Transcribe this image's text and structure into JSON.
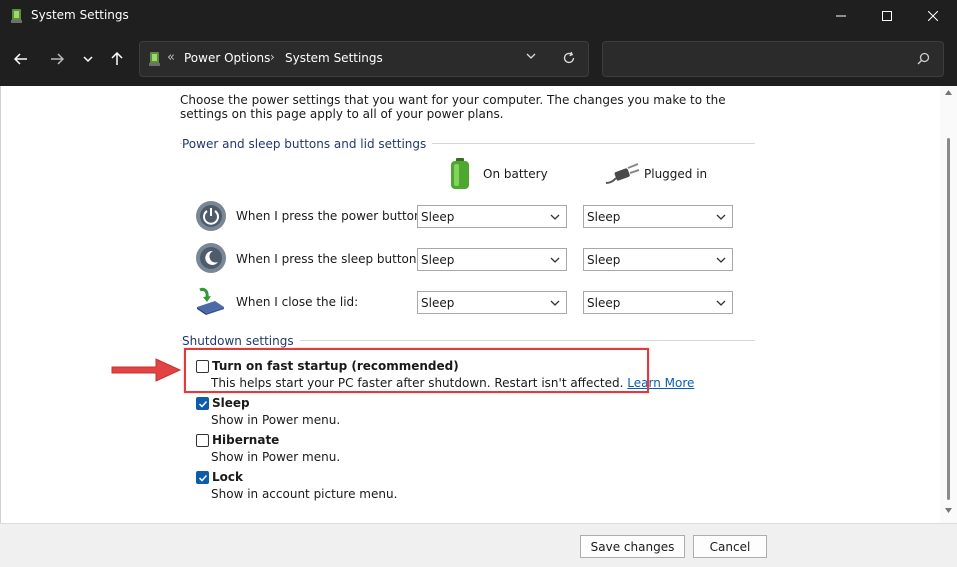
{
  "window": {
    "title": "System Settings"
  },
  "address": {
    "crumbs": [
      "Power Options",
      "System Settings"
    ],
    "search_placeholder": ""
  },
  "intro": "Choose the power settings that you want for your computer. The changes you make to the settings on this page apply to all of your power plans.",
  "power_section": {
    "label": "Power and sleep buttons and lid settings",
    "columns": [
      "On battery",
      "Plugged in"
    ],
    "rows": [
      {
        "label": "When I press the power button:",
        "battery": "Sleep",
        "plugged": "Sleep"
      },
      {
        "label": "When I press the sleep button:",
        "battery": "Sleep",
        "plugged": "Sleep"
      },
      {
        "label": "When I close the lid:",
        "battery": "Sleep",
        "plugged": "Sleep"
      }
    ]
  },
  "shutdown_section": {
    "label": "Shutdown settings",
    "options": [
      {
        "title": "Turn on fast startup (recommended)",
        "desc": "This helps start your PC faster after shutdown. Restart isn't affected.",
        "link": "Learn More",
        "checked": false
      },
      {
        "title": "Sleep",
        "desc": "Show in Power menu.",
        "checked": true
      },
      {
        "title": "Hibernate",
        "desc": "Show in Power menu.",
        "checked": false
      },
      {
        "title": "Lock",
        "desc": "Show in account picture menu.",
        "checked": true
      }
    ]
  },
  "footer": {
    "save_label": "Save changes",
    "cancel_label": "Cancel"
  },
  "colors": {
    "titlebar": "#1f1f1f",
    "accent": "#0b5cad",
    "highlight": "#e03b3b",
    "group_label": "#1e3a6e"
  }
}
